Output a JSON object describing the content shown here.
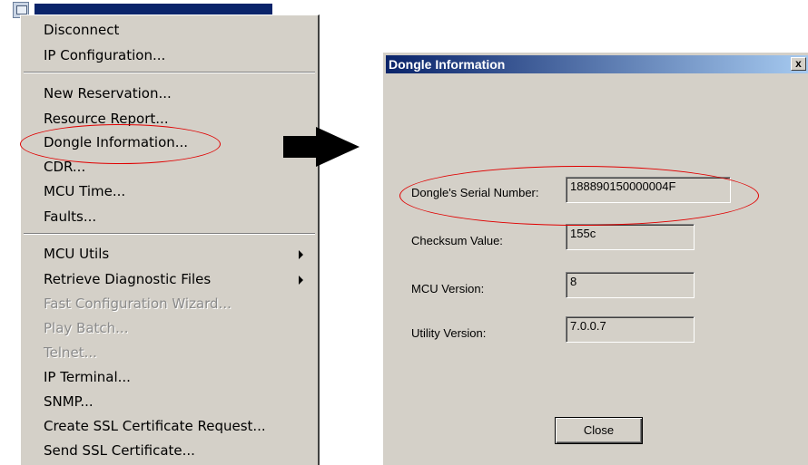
{
  "menu": {
    "items": [
      {
        "label": "Disconnect",
        "enabled": true
      },
      {
        "label": "IP Configuration...",
        "enabled": true
      },
      {
        "label": "New Reservation...",
        "enabled": true
      },
      {
        "label": "Resource Report...",
        "enabled": true
      },
      {
        "label": "Dongle Information...",
        "enabled": true,
        "highlighted": true
      },
      {
        "label": "CDR...",
        "enabled": true
      },
      {
        "label": "MCU Time...",
        "enabled": true
      },
      {
        "label": "Faults...",
        "enabled": true
      },
      {
        "label": "MCU Utils",
        "enabled": true,
        "submenu": true
      },
      {
        "label": "Retrieve Diagnostic Files",
        "enabled": true,
        "submenu": true
      },
      {
        "label": "Fast Configuration Wizard...",
        "enabled": false
      },
      {
        "label": "Play Batch...",
        "enabled": false
      },
      {
        "label": "Telnet...",
        "enabled": false
      },
      {
        "label": "IP Terminal...",
        "enabled": true
      },
      {
        "label": "SNMP...",
        "enabled": true
      },
      {
        "label": "Create SSL Certificate Request...",
        "enabled": true
      },
      {
        "label": "Send SSL Certificate...",
        "enabled": true
      }
    ]
  },
  "dialog": {
    "title": "Dongle Information",
    "close_glyph": "x",
    "fields": [
      {
        "label": "Dongle's Serial Number:",
        "value": "188890150000004F",
        "highlighted": true
      },
      {
        "label": "Checksum Value:",
        "value": "155c"
      },
      {
        "label": "MCU Version:",
        "value": "8"
      },
      {
        "label": "Utility Version:",
        "value": "7.0.0.7"
      }
    ],
    "close_button_label": "Close"
  },
  "colors": {
    "highlight_ellipse": "#e00000",
    "titlebar_start": "#0a246a",
    "titlebar_end": "#a6caf0",
    "window_face": "#d4d0c8"
  },
  "icons": {
    "submenu": "chevron-right-icon",
    "pointer": "arrow-right-icon"
  }
}
